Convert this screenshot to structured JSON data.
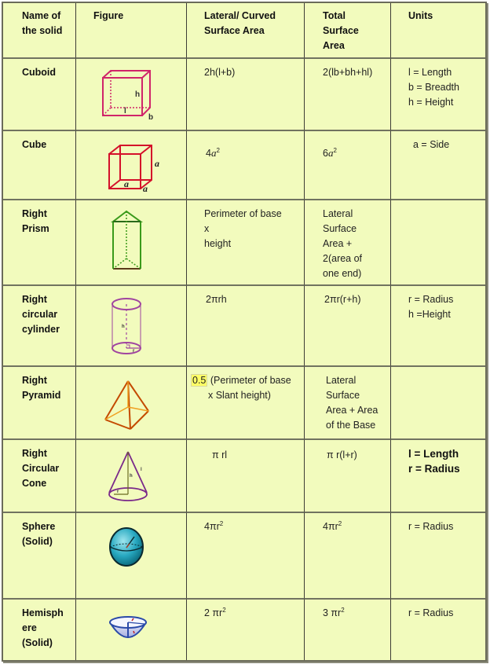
{
  "header": {
    "name": "Name of the solid",
    "name_l1": "Name of",
    "name_l2": "the solid",
    "figure": "Figure",
    "lateral_l1": "Lateral/ Curved",
    "lateral_l2": "Surface Area",
    "total_l1": "Total",
    "total_l2": "Surface",
    "total_l3": "Area",
    "units": "Units"
  },
  "rows": [
    {
      "name_lines": [
        "Cuboid"
      ],
      "figure_icon": "cuboid-icon",
      "figure_labels": {
        "l": "l",
        "b": "b",
        "h": "h"
      },
      "lateral": [
        "2h(l+b)"
      ],
      "total": [
        "2(lb+bh+hl)"
      ],
      "units": [
        "l  = Length",
        "b = Breadth",
        "h = Height"
      ]
    },
    {
      "name_lines": [
        "Cube"
      ],
      "figure_icon": "cube-icon",
      "figure_labels": {
        "a": "a"
      },
      "lateral_coef": "4",
      "lateral_var": "a",
      "lateral_exp": "2",
      "total_coef": "6",
      "total_var": "a",
      "total_exp": "2",
      "units": [
        "a  = Side"
      ]
    },
    {
      "name_lines": [
        "Right",
        "Prism"
      ],
      "figure_icon": "triangular-prism-icon",
      "lateral": [
        "Perimeter of base",
        "x",
        "height"
      ],
      "total": [
        "Lateral",
        "Surface",
        "Area +",
        "2(area of",
        "one end)"
      ],
      "units": []
    },
    {
      "name_lines": [
        "Right",
        "circular",
        "cylinder"
      ],
      "figure_icon": "cylinder-icon",
      "figure_labels": {
        "h": "h",
        "r": "r"
      },
      "lateral": [
        "2πrh"
      ],
      "total": [
        "2πr(r+h)"
      ],
      "units": [
        "r  = Radius",
        "h  =Height"
      ]
    },
    {
      "name_lines": [
        "Right",
        "Pyramid"
      ],
      "figure_icon": "pyramid-icon",
      "lateral_highlight": "0.5",
      "lateral": [
        "(Perimeter of base",
        "x Slant height)"
      ],
      "total": [
        "Lateral",
        "Surface",
        "Area + Area",
        "of the Base"
      ],
      "units": []
    },
    {
      "name_lines": [
        "Right",
        "Circular",
        "Cone"
      ],
      "figure_icon": "cone-icon",
      "figure_labels": {
        "h": "h",
        "l": "l",
        "r": "r"
      },
      "lateral": [
        "π rl"
      ],
      "total": [
        "π r(l+r)"
      ],
      "units": [
        "l  = Length",
        "r = Radius"
      ]
    },
    {
      "name_lines": [
        "Sphere",
        "(Solid)"
      ],
      "figure_icon": "sphere-icon",
      "lateral_base": "4πr",
      "lateral_exp": "2",
      "total_base": "4πr",
      "total_exp": "2",
      "units": [
        "r = Radius"
      ]
    },
    {
      "name_lines": [
        "Hemisph",
        "ere",
        "(Solid)"
      ],
      "figure_icon": "hemisphere-icon",
      "lateral_base": "2 πr",
      "lateral_exp": "2",
      "total_base": "3 πr",
      "total_exp": "2",
      "units": [
        "r = Radius"
      ]
    }
  ],
  "colors": {
    "table_bg": "#f2fbbd",
    "cuboid": "#d0246a",
    "cube": "#d4102a",
    "prism": "#3a9a1a",
    "cylinder": "#a045a0",
    "pyramid": "#c44a00",
    "cone": "#7a2a8a",
    "sphere": "#1a9ab0",
    "hemisphere": "#2a4aa8",
    "highlight": "#ffff66"
  }
}
